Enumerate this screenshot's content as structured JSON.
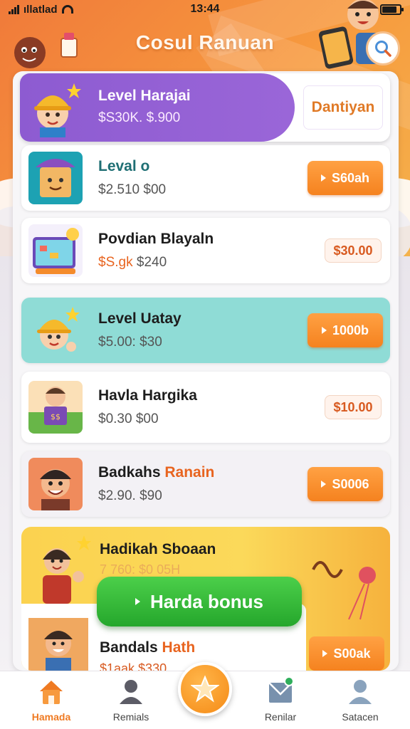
{
  "status_bar": {
    "carrier": "ıllatlad",
    "time": "13:44"
  },
  "header": {
    "title": "Cosul Ranuan"
  },
  "featured": {
    "title": "Level Harajai",
    "subtitle": "$S30K. $.900",
    "cta_label": "Dantiyan"
  },
  "rows": [
    {
      "title": "Leval o",
      "subtitle": "$2.510  $00",
      "action_label": "S60ah",
      "action_type": "button"
    },
    {
      "title": "Povdian Blayaln",
      "subtitle_accent": "$S.gk",
      "subtitle_rest": " $240",
      "action_label": "$30.00",
      "action_type": "chip"
    },
    {
      "title": "Level Uatay",
      "subtitle": "$5.00: $30",
      "action_label": "1000b",
      "action_type": "button"
    },
    {
      "title": "Havla Hargika",
      "subtitle": "$0.30  $00",
      "action_label": "$10.00",
      "action_type": "chip"
    },
    {
      "title_main": "Badkahs ",
      "title_accent": "Ranain",
      "subtitle": "$2.90. $90",
      "action_label": "S0006",
      "action_type": "button"
    }
  ],
  "bottom_card": {
    "title": "Hadikah Sboaan",
    "faint_text": "7 760: $0 05H",
    "row_title_main": "Bandals ",
    "row_title_accent": "Hath",
    "row_subtitle": "$1aak  $330",
    "row_action_label": "S00ak"
  },
  "bonus_button": {
    "label": "Harda bonus"
  },
  "tabs": [
    {
      "label": "Hamada",
      "icon": "house-icon",
      "active": true
    },
    {
      "label": "Remials",
      "icon": "person-icon",
      "active": false
    },
    {
      "label": "Renilar",
      "icon": "envelope-icon",
      "active": false
    },
    {
      "label": "Satacen",
      "icon": "profile-icon",
      "active": false
    }
  ],
  "colors": {
    "accent_orange": "#f5821f",
    "featured_purple": "#8d5bd1",
    "highlight_teal": "#8fdcd6",
    "bonus_green": "#2fb43a",
    "hero_gradient_start": "#f07a3a"
  }
}
